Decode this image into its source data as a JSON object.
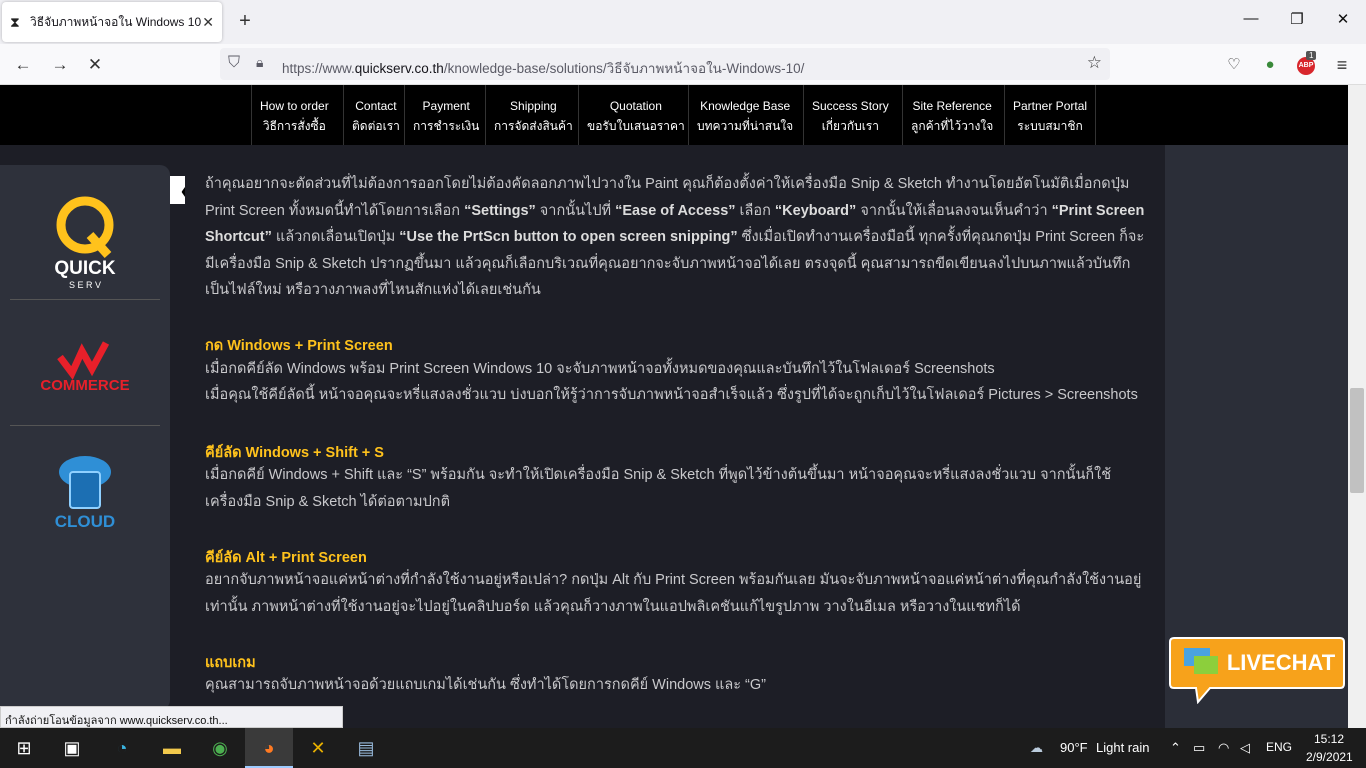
{
  "browser": {
    "tab_title": "วิธีจับภาพหน้าจอใน Windows 10",
    "url_prefix": "https://www.",
    "url_host": "quickserv.co.th",
    "url_path": "/knowledge-base/solutions/วิธีจับภาพหน้าจอใน-Windows-10/",
    "abp_count": "1",
    "abp_label": "ABP"
  },
  "nav": [
    {
      "en": "How to order",
      "th": "วิธีการสั่งซื้อ"
    },
    {
      "en": "Contact",
      "th": "ติดต่อเรา"
    },
    {
      "en": "Payment",
      "th": "การชำระเงิน"
    },
    {
      "en": "Shipping",
      "th": "การจัดส่งสินค้า"
    },
    {
      "en": "Quotation",
      "th": "ขอรับใบเสนอราคา"
    },
    {
      "en": "Knowledge Base",
      "th": "บทความที่น่าสนใจ"
    },
    {
      "en": "Success Story",
      "th": "เกี่ยวกับเรา"
    },
    {
      "en": "Site Reference",
      "th": "ลูกค้าที่ไว้วางใจ"
    },
    {
      "en": "Partner Portal",
      "th": "ระบบสมาชิก"
    }
  ],
  "sidebar": {
    "quick": "QUICK",
    "serv": "S E R V",
    "commerce": "COMMERCE",
    "cloud": "CLOUD"
  },
  "content": {
    "p1a": "ถ้าคุณอยากจะตัดส่วนที่ไม่ต้องการออกโดยไม่ต้องคัดลอกภาพไปวางใน Paint คุณก็ต้องตั้งค่าให้เครื่องมือ Snip & Sketch ทำงานโดยอัตโนมัติเมื่อกดปุ่ม Print Screen ทั้งหมดนี้ทำได้โดยการเลือก ",
    "p1b": "“Settings”",
    "p1c": " จากนั้นไปที่ ",
    "p1d": "“Ease of Access”",
    "p1e": " เลือก ",
    "p1f": "“Keyboard”",
    "p1g": " จากนั้นให้เลื่อนลงจนเห็นคำว่า ",
    "p1h": "“Print Screen Shortcut”",
    "p1i": " แล้วกดเลื่อนเปิดปุ่ม ",
    "p1j": "“Use the PrtScn button to open screen snipping”",
    "p1k": " ซึ่งเมื่อเปิดทำงานเครื่องมือนี้ ทุกครั้งที่คุณกดปุ่ม Print Screen ก็จะมีเครื่องมือ Snip & Sketch ปรากฏขึ้นมา แล้วคุณก็เลือกบริเวณที่คุณอยากจะจับภาพหน้าจอได้เลย ตรงจุดนี้ คุณสามารถขีดเขียนลงไปบนภาพแล้วบันทึกเป็นไฟล์ใหม่ หรือวางภาพลงที่ไหนสักแห่งได้เลยเช่นกัน",
    "h2": "กด Windows + Print Screen",
    "p2": "เมื่อกดคีย์ลัด Windows พร้อม Print Screen Windows 10 จะจับภาพหน้าจอทั้งหมดของคุณและบันทึกไว้ในโฟลเดอร์ Screenshots",
    "p3": "เมื่อคุณใช้คีย์ลัดนี้ หน้าจอคุณจะหรี่แสงลงชั่วแวบ บ่งบอกให้รู้ว่าการจับภาพหน้าจอสำเร็จแล้ว  ซึ่งรูปที่ได้จะถูกเก็บไว้ในโฟลเดอร์ Pictures > Screenshots",
    "h3": "คีย์ลัด Windows + Shift + S",
    "p4": "เมื่อกดคีย์ Windows + Shift และ “S” พร้อมกัน จะทำให้เปิดเครื่องมือ Snip & Sketch ที่พูดไว้ข้างต้นขึ้นมา หน้าจอคุณจะหรี่แสงลงชั่วแวบ จากนั้นก็ใช้เครื่องมือ Snip & Sketch ได้ต่อตามปกติ",
    "h4": "คีย์ลัด Alt + Print Screen",
    "p5": "อยากจับภาพหน้าจอแค่หน้าต่างที่กำลังใช้งานอยู่หรือเปล่า? กดปุ่ม Alt กับ Print Screen พร้อมกันเลย มันจะจับภาพหน้าจอแค่หน้าต่างที่คุณกำลังใช้งานอยู่เท่านั้น ภาพหน้าต่างที่ใช้งานอยู่จะไปอยู่ในคลิปบอร์ด แล้วคุณก็วางภาพในแอปพลิเคชันแก้ไขรูปภาพ วางในอีเมล หรือวางในแชทก็ได้",
    "h5": "แถบเกม",
    "p6": "คุณสามารถจับภาพหน้าจอด้วยแถบเกมได้เช่นกัน ซึ่งทำได้โดยการกดคีย์ Windows และ “G”"
  },
  "livechat": "LIVECHAT",
  "status": "กำลังถ่ายโอนข้อมูลจาก www.quickserv.co.th...",
  "taskbar": {
    "weather_temp": "90°F",
    "weather_text": "Light rain",
    "lang": "ENG",
    "time": "15:12",
    "date": "2/9/2021"
  }
}
